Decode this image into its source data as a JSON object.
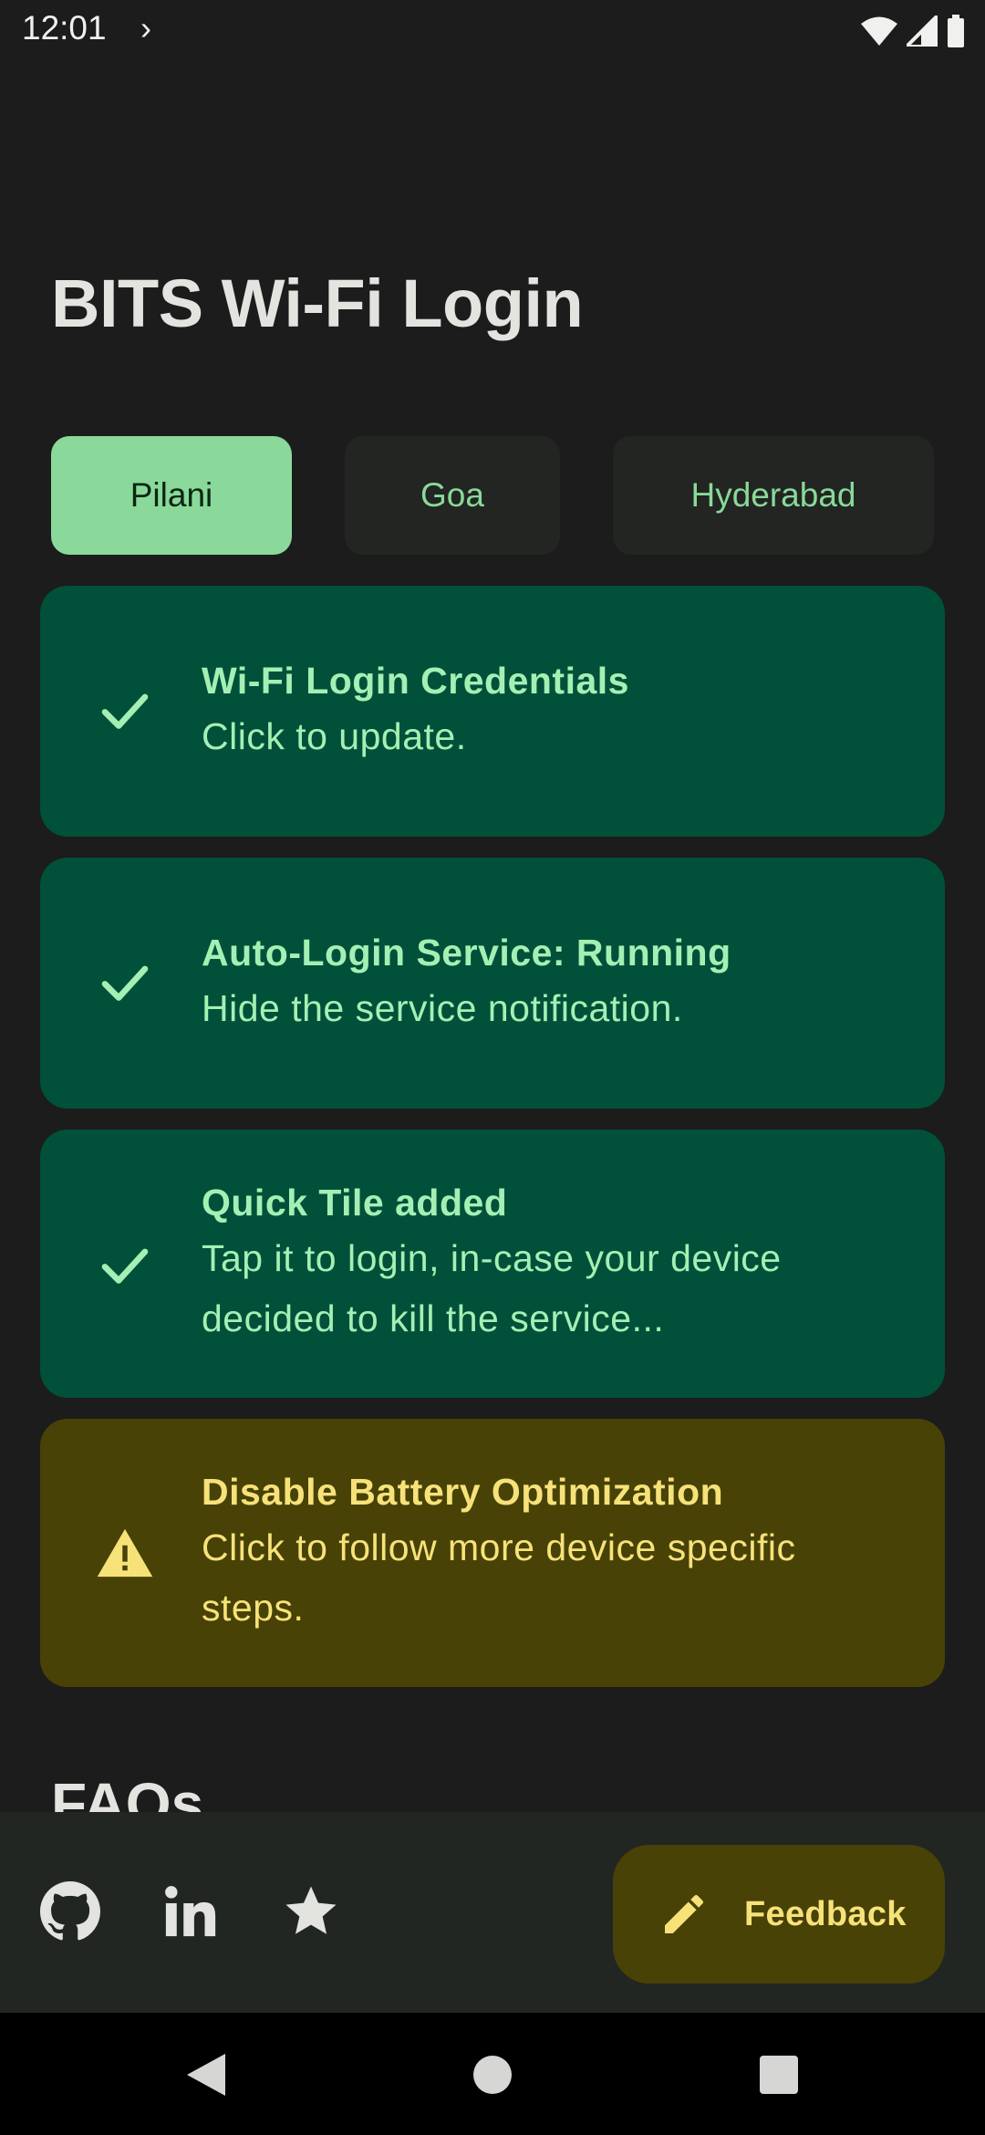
{
  "status_bar": {
    "time": "12:01",
    "chevron": "›"
  },
  "app": {
    "title": "BITS Wi-Fi Login"
  },
  "campus_tabs": [
    {
      "label": "Pilani",
      "selected": true
    },
    {
      "label": "Goa",
      "selected": false
    },
    {
      "label": "Hyderabad",
      "selected": false
    }
  ],
  "cards": [
    {
      "icon": "check-icon",
      "title": "Wi-Fi Login Credentials",
      "subtitle": "Click to update.",
      "status": "ok"
    },
    {
      "icon": "check-icon",
      "title": "Auto-Login Service: Running",
      "subtitle": "Hide the service notification.",
      "status": "ok"
    },
    {
      "icon": "check-icon",
      "title": "Quick Tile added",
      "subtitle": "Tap it to login, in-case your device decided to kill the service...",
      "status": "ok"
    },
    {
      "icon": "warning-icon",
      "title": "Disable Battery Optimization",
      "subtitle": "Click to follow more device specific steps.",
      "status": "warning"
    }
  ],
  "faq": {
    "heading": "FAQs"
  },
  "bottom_bar": {
    "icons": [
      "github-icon",
      "linkedin-icon",
      "star-icon"
    ],
    "fab": {
      "icon": "pencil-icon",
      "label": "Feedback"
    }
  },
  "colors": {
    "background": "#1b1c1b",
    "accent_green": "#8ad99a",
    "card_ok": "#01503a",
    "card_warning": "#484207",
    "warning_text": "#f7e27a"
  }
}
